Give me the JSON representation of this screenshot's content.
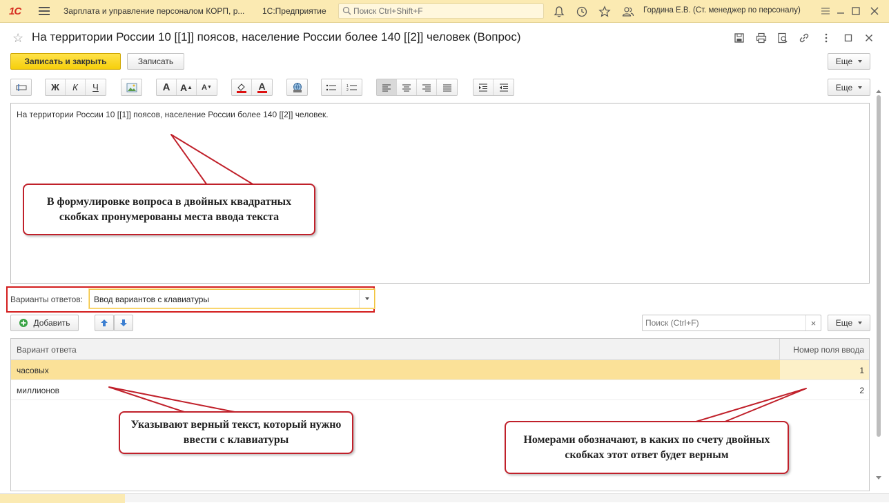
{
  "app": {
    "logo": "1С",
    "title": "Зарплата и управление персоналом КОРП, р...",
    "platform": "1С:Предприятие",
    "search_placeholder": "Поиск Ctrl+Shift+F",
    "user": "Гордина Е.В. (Ст. менеджер по персоналу)"
  },
  "form": {
    "title": "На территории России 10 [[1]] поясов, население России более 140 [[2]] человек (Вопрос)",
    "save_close_label": "Записать и закрыть",
    "save_label": "Записать",
    "more_label": "Еще",
    "editor_more_label": "Еще",
    "editor_text": "На территории России 10 [[1]] поясов, население России более 140 [[2]] человек.",
    "toolbar_format": {
      "bold": "Ж",
      "italic": "К",
      "underline": "Ч",
      "font_size_letter": "A",
      "font_size_up_letter": "A",
      "font_size_down_letter": "A",
      "color_letter": "A"
    },
    "variants_label": "Варианты ответов:",
    "variants_value": "Ввод вариантов с клавиатуры",
    "add_label": "Добавить",
    "list_search_placeholder": "Поиск (Ctrl+F)",
    "clear_symbol": "×",
    "list_more_label": "Еще",
    "table": {
      "columns": [
        "Вариант ответа",
        "Номер поля ввода"
      ],
      "rows": [
        {
          "answer": "часовых",
          "field": "1"
        },
        {
          "answer": "миллионов",
          "field": "2"
        }
      ]
    }
  },
  "callouts": {
    "question_note": "В формулировке вопроса в двойных квадратных скобках пронумерованы места ввода текста",
    "answer_note": "Указывают верный текст, который нужно ввести с клавиатуры",
    "number_note": "Номерами обозначают, в каких по счету двойных скобках этот ответ будет верным"
  },
  "colors": {
    "appbar": "#fbeab2",
    "primary_button": "#f6cf0b",
    "selected_row": "#fbe198",
    "callout_border": "#c0202a",
    "highlight_frame": "#d31d1d"
  }
}
